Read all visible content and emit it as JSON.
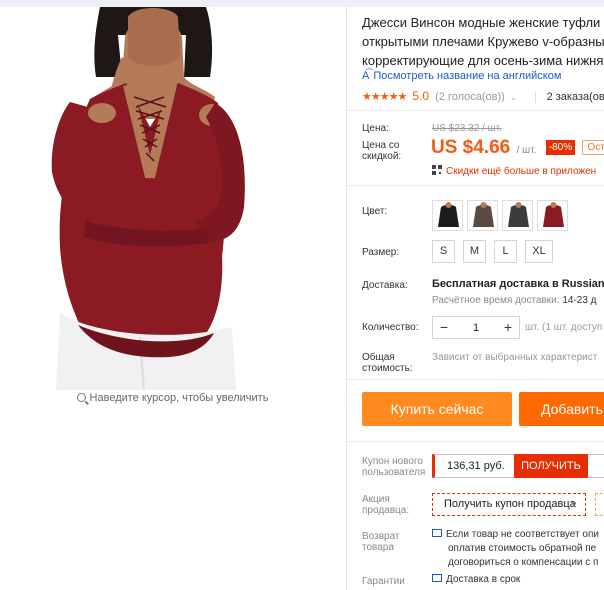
{
  "product": {
    "title_lines": [
      "Джесси Винсон модные женские туфли Т",
      "открытыми плечами Кружево v-образны",
      "корректирующие для осень-зима нижня"
    ],
    "translate_link": "Посмотреть название на английском",
    "rating": {
      "stars": "★★★★★",
      "value": "5.0",
      "votes": "(2 голоса(ов))",
      "orders": "2 заказа(ов)"
    },
    "zoom_hint": "Наведите курсор, чтобы увеличить"
  },
  "price": {
    "old_label": "Цена:",
    "old_value": "US $23.32 / шт.",
    "discount_label_line1": "Цена со",
    "discount_label_line2": "скидкой:",
    "current": "US $4.66",
    "unit": "/ шт.",
    "discount_badge": "-80%",
    "promo_tag": "Оста",
    "app_discount": "Скидки ещё больше в приложен"
  },
  "options": {
    "color_label": "Цвет:",
    "size_label": "Размер:",
    "sizes": [
      "S",
      "M",
      "L",
      "XL"
    ],
    "shipping_label": "Доставка:",
    "shipping_value": "Бесплатная доставка в Russian Fe",
    "shipping_time_label": "Расчётное время доставки:",
    "shipping_time_value": "14-23 д",
    "quantity_label": "Количество:",
    "quantity_value": "1",
    "quantity_minus": "−",
    "quantity_plus": "+",
    "quantity_note": "шт. (1 шт. доступ",
    "total_label_line1": "Общая",
    "total_label_line2": "стоимость:",
    "total_value": "Зависит от выбранных характерист"
  },
  "actions": {
    "buy_now": "Купить сейчас",
    "add_to_cart": "Добавить"
  },
  "promotions": {
    "new_user_label_line1": "Купон нового",
    "new_user_label_line2": "пользователя",
    "new_user_amount": "136,31 руб.",
    "get_button": "ПОЛУЧИТЬ",
    "seller_label_line1": "Акция",
    "seller_label_line2": "продавца:",
    "seller_coupon": "Получить купон продавца"
  },
  "returns": {
    "label_line1": "Возврат",
    "label_line2": "товара",
    "lines": [
      "Если товар не соответствует опи",
      "оплатив стоимость обратной пе",
      "договориться о компенсации с п"
    ]
  },
  "guarantee": {
    "label": "Гарантии",
    "value": "Доставка в срок"
  },
  "colors": {
    "price": "#f45b11",
    "accent": "#e62e04",
    "buy": "#ff8a1f",
    "cart": "#ff6a00",
    "link": "#1a5bc7",
    "garment": "#8b1a22"
  }
}
